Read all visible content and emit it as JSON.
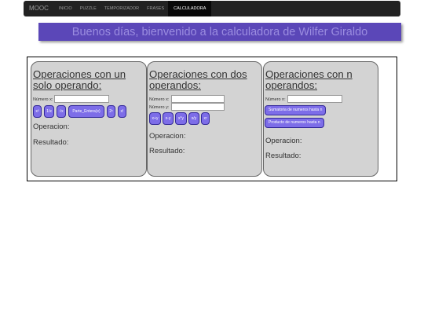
{
  "navbar": {
    "brand": "MOOC",
    "items": [
      {
        "label": "INICIO",
        "active": false
      },
      {
        "label": "PUZZLE",
        "active": false
      },
      {
        "label": "TEMPORIZADOR",
        "active": false
      },
      {
        "label": "FRASES",
        "active": false
      },
      {
        "label": "CALCULADORA",
        "active": true
      }
    ]
  },
  "banner": {
    "text": "Buenos días, bienvenido a la calculadora de Wilfer Giraldo"
  },
  "panels": {
    "single": {
      "title": "Operaciones con un solo operando:",
      "field_x_label": "Número x:",
      "buttons": [
        "x²",
        "1/x",
        "√x",
        "Parte_Entera(x)",
        "2ˣ",
        "x!"
      ],
      "operation_label": "Operacion:",
      "result_label": "Resultado:"
    },
    "double": {
      "title": "Operaciones con dos operandos:",
      "field_x_label": "Número x:",
      "field_y_label": "Número y:",
      "buttons": [
        "x+y",
        "x-y",
        "x*y",
        "x/y",
        "xʸ"
      ],
      "operation_label": "Operacion:",
      "result_label": "Resultado:"
    },
    "n": {
      "title": "Operaciones con n operandos:",
      "field_n_label": "Número n:",
      "buttons": [
        "Sumatoria de numeros hasta n",
        "Producto de numeros hasta n"
      ],
      "operation_label": "Operacion:",
      "result_label": "Resultado:"
    }
  },
  "colors": {
    "navbar_bg": "#222222",
    "banner_bg": "#5b47b8",
    "banner_text": "#9b8de0",
    "panel_bg": "#d3d3d3",
    "button_bg": "#7d6de8"
  }
}
